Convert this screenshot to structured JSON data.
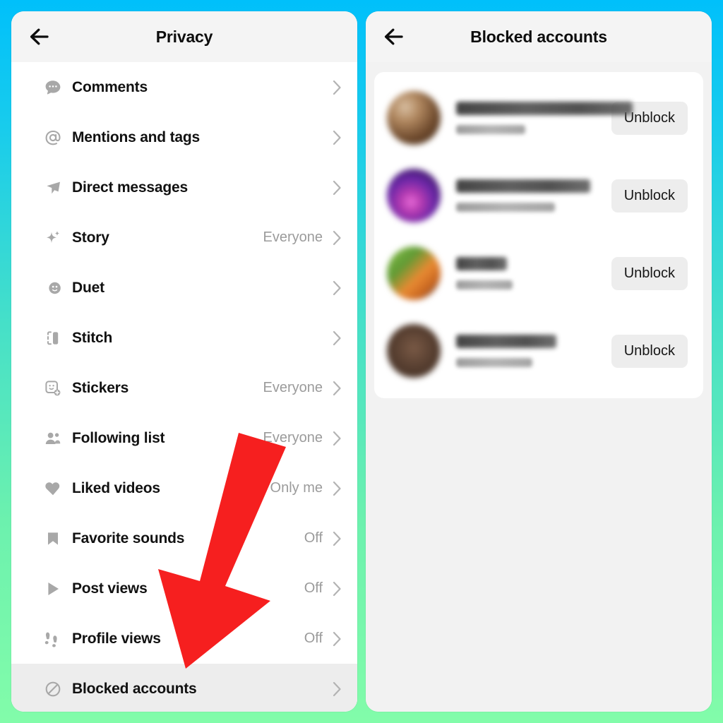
{
  "theme": {
    "background_gradient_top": "#00c0fb",
    "background_gradient_bottom": "#82fcaa",
    "arrow_color": "#f61f1f",
    "card_background": "#ffffff",
    "page_background": "#f2f2f2",
    "header_background": "#f4f4f4",
    "icon_color": "#a8a8a8",
    "value_text_color": "#9b9b9b",
    "highlight_row_background": "#ededed"
  },
  "privacy_screen": {
    "title": "Privacy",
    "back_icon": "arrow-left-icon",
    "rows": [
      {
        "label": "Comments",
        "value": "",
        "icon": "comment-bubble-icon",
        "chevron": "chevron-right-icon",
        "highlighted": false
      },
      {
        "label": "Mentions and tags",
        "value": "",
        "icon": "at-sign-icon",
        "chevron": "chevron-right-icon",
        "highlighted": false
      },
      {
        "label": "Direct messages",
        "value": "",
        "icon": "paper-plane-icon",
        "chevron": "chevron-right-icon",
        "highlighted": false
      },
      {
        "label": "Story",
        "value": "Everyone",
        "icon": "sparkle-icon",
        "chevron": "chevron-right-icon",
        "highlighted": false
      },
      {
        "label": "Duet",
        "value": "",
        "icon": "duet-circles-icon",
        "chevron": "chevron-right-icon",
        "highlighted": false
      },
      {
        "label": "Stitch",
        "value": "",
        "icon": "stitch-icon",
        "chevron": "chevron-right-icon",
        "highlighted": false
      },
      {
        "label": "Stickers",
        "value": "Everyone",
        "icon": "sticker-icon",
        "chevron": "chevron-right-icon",
        "highlighted": false
      },
      {
        "label": "Following list",
        "value": "Everyone",
        "icon": "people-icon",
        "chevron": "chevron-right-icon",
        "highlighted": false
      },
      {
        "label": "Liked videos",
        "value": "Only me",
        "icon": "heart-icon",
        "chevron": "chevron-right-icon",
        "highlighted": false
      },
      {
        "label": "Favorite sounds",
        "value": "Off",
        "icon": "bookmark-icon",
        "chevron": "chevron-right-icon",
        "highlighted": false
      },
      {
        "label": "Post views",
        "value": "Off",
        "icon": "play-triangle-icon",
        "chevron": "chevron-right-icon",
        "highlighted": false
      },
      {
        "label": "Profile views",
        "value": "Off",
        "icon": "footprints-icon",
        "chevron": "chevron-right-icon",
        "highlighted": false
      },
      {
        "label": "Blocked accounts",
        "value": "",
        "icon": "block-circle-icon",
        "chevron": "chevron-right-icon",
        "highlighted": true
      }
    ]
  },
  "blocked_screen": {
    "title": "Blocked accounts",
    "back_icon": "arrow-left-icon",
    "accounts": [
      {
        "display_name": "",
        "username": "",
        "avatar": "avatar-1",
        "action_label": "Unblock",
        "redacted": true
      },
      {
        "display_name": "",
        "username": "",
        "avatar": "avatar-2",
        "action_label": "Unblock",
        "redacted": true
      },
      {
        "display_name": "",
        "username": "",
        "avatar": "avatar-3",
        "action_label": "Unblock",
        "redacted": true
      },
      {
        "display_name": "",
        "username": "",
        "avatar": "avatar-4",
        "action_label": "Unblock",
        "redacted": true
      }
    ]
  },
  "annotation": {
    "arrow_icon": "down-left-arrow-annotation",
    "points_to": "Blocked accounts"
  }
}
